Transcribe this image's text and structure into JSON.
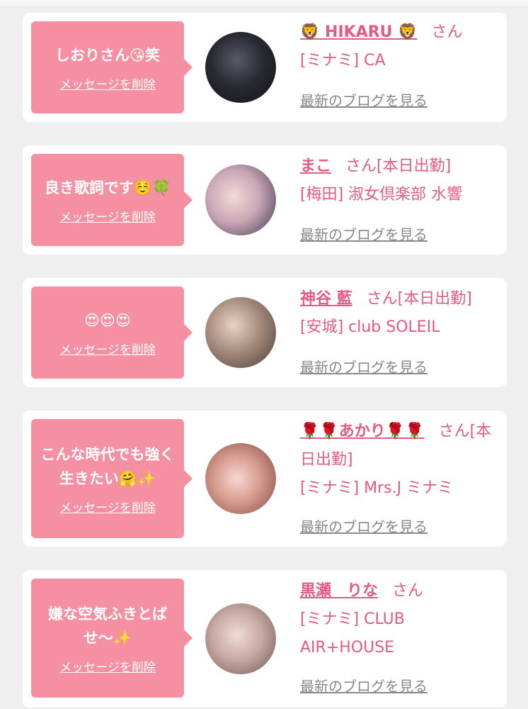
{
  "cards": [
    {
      "message": "しおりさん😘笑",
      "delete_label": "メッセージを削除",
      "name": "🦁 HIKARU 🦁",
      "suffix": "さん",
      "shop": "[ミナミ] CA",
      "blog_link": "最新のブログを見る"
    },
    {
      "message": "良き歌詞です☺️🍀",
      "delete_label": "メッセージを削除",
      "name": "まこ",
      "suffix": "さん[本日出勤]",
      "shop": "[梅田] 淑女倶楽部 水響",
      "blog_link": "最新のブログを見る"
    },
    {
      "message": "😍😍😍",
      "delete_label": "メッセージを削除",
      "name": "神谷 藍",
      "suffix": "さん[本日出勤]",
      "shop": "[安城] club SOLEIL",
      "blog_link": "最新のブログを見る"
    },
    {
      "message": "こんな時代でも強く生きたい🤗✨",
      "delete_label": "メッセージを削除",
      "name": "🌹🌹あかり🌹🌹",
      "suffix": "さん[本日出勤]",
      "shop": "[ミナミ] Mrs.J ミナミ",
      "blog_link": "最新のブログを見る"
    },
    {
      "message": "嫌な空気ふきとばせ〜✨",
      "delete_label": "メッセージを削除",
      "name": "黒瀬　りな",
      "suffix": "さん",
      "shop": "[ミナミ] CLUB AIR+HOUSE",
      "blog_link": "最新のブログを見る"
    }
  ],
  "colors": {
    "accent_pink": "#f58fa2",
    "name_pink": "#e45a82",
    "link_gray": "#888888"
  }
}
